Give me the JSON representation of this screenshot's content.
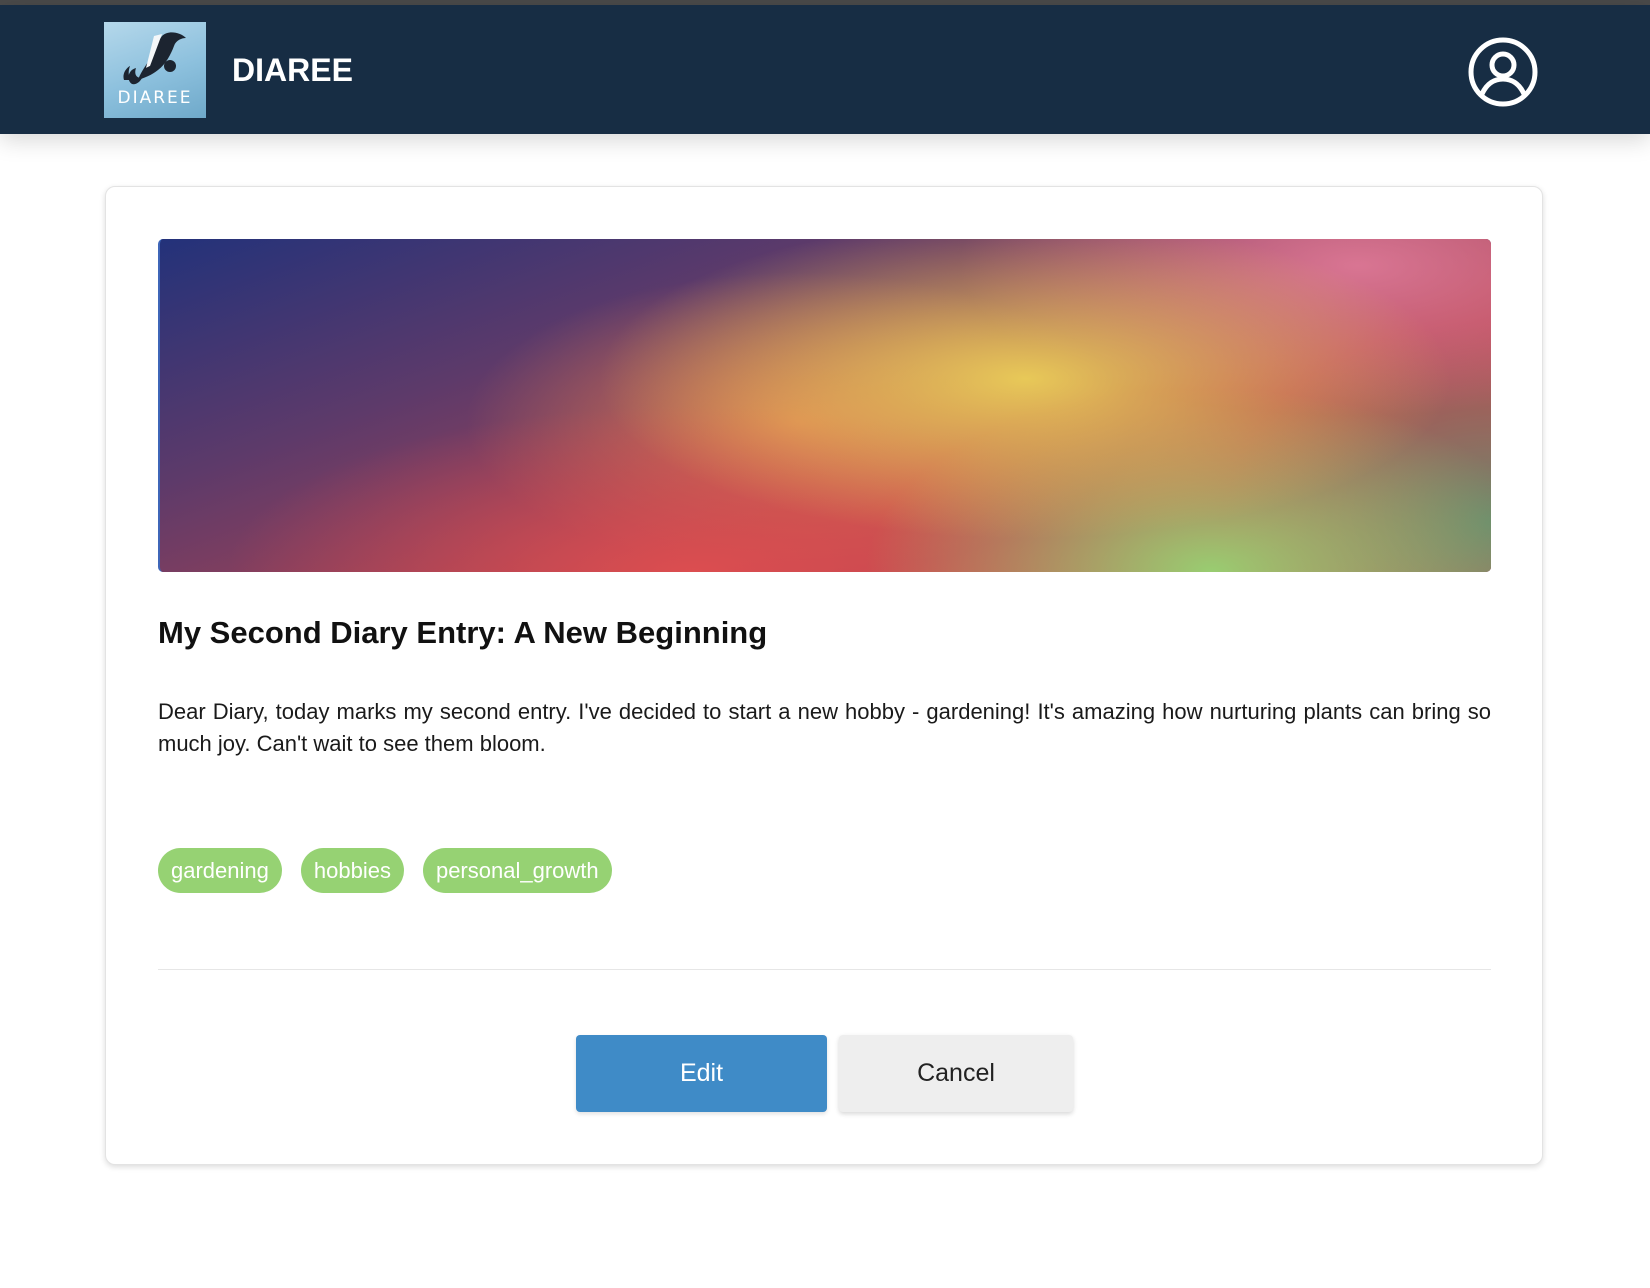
{
  "header": {
    "logo_text": "DIAREE",
    "brand_name": "DIAREE",
    "logo_icon": "pen-nib-logo-icon",
    "account_icon": "user-circle-icon",
    "background_color": "#172d44"
  },
  "entry": {
    "title": "My Second Diary Entry: A New Beginning",
    "body": "Dear Diary, today marks my second entry. I've decided to start a new hobby - gardening! It's amazing how nurturing plants can bring so much joy. Can't wait to see them bloom.",
    "tags": [
      "gardening",
      "hobbies",
      "personal_growth"
    ],
    "tag_color": "#96d273"
  },
  "actions": {
    "edit_label": "Edit",
    "cancel_label": "Cancel",
    "edit_color": "#3f8bc7",
    "cancel_color": "#eeeeee"
  }
}
